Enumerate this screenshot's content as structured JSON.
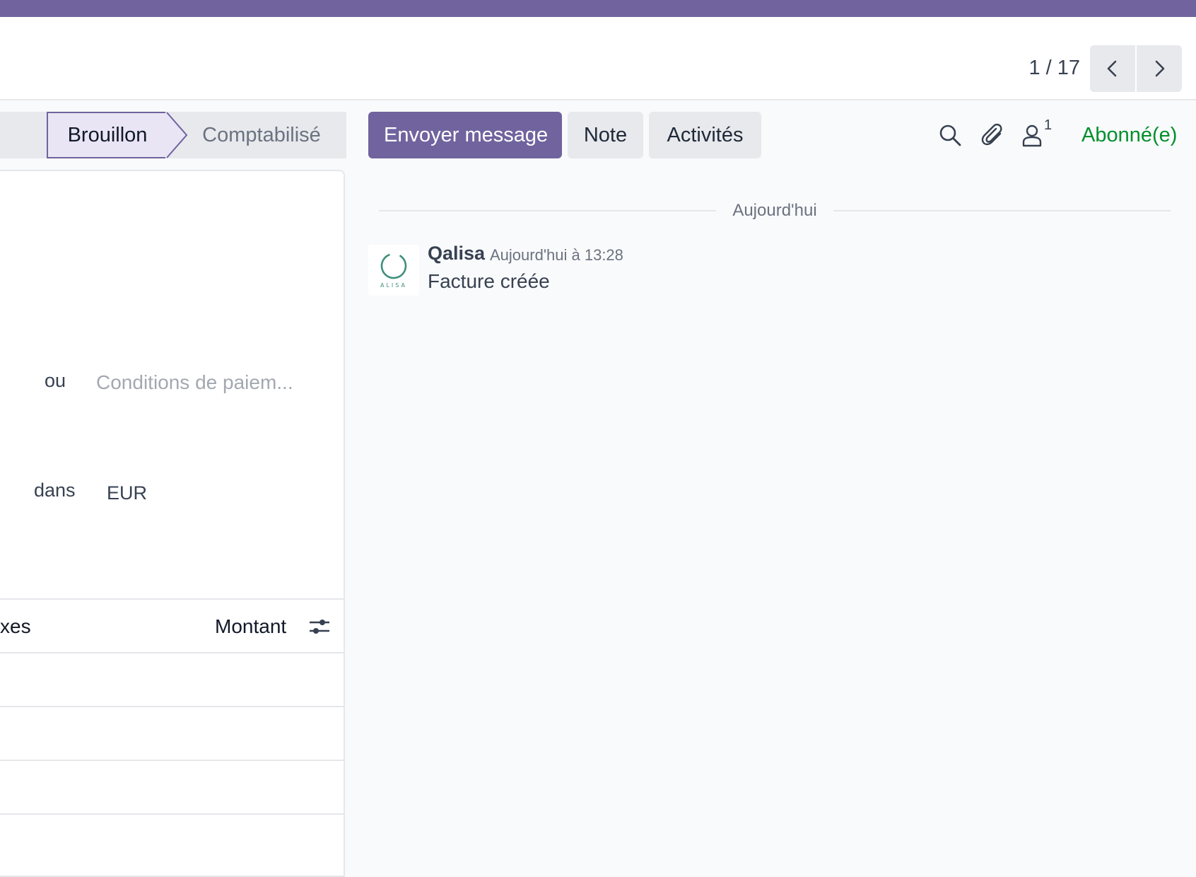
{
  "header": {
    "pager_value": "1 / 17",
    "prev_icon": "chevron-left-icon",
    "next_icon": "chevron-right-icon"
  },
  "statusbar": {
    "stages": [
      {
        "label": "Brouillon",
        "active": true
      },
      {
        "label": "Comptabilisé",
        "active": false
      }
    ]
  },
  "form": {
    "payment_or_label": "ou",
    "payment_terms_placeholder": "Conditions de paiem...",
    "currency_label": "dans",
    "currency_value": "EUR",
    "lines_table": {
      "columns": [
        "xes",
        "Montant"
      ],
      "settings_icon": "sliders-icon"
    }
  },
  "chatter": {
    "send_message_label": "Envoyer message",
    "note_label": "Note",
    "activities_label": "Activités",
    "search_icon": "search-icon",
    "attachment_icon": "paperclip-icon",
    "followers_icon": "user-icon",
    "followers_count": "1",
    "follow_status": "Abonné(e)",
    "date_separator": "Aujourd'hui",
    "messages": [
      {
        "author": "Qalisa",
        "date": "Aujourd'hui à 13:28",
        "body": "Facture créée",
        "avatar_text": "ALISA"
      }
    ]
  },
  "colors": {
    "brand": "#71639e",
    "follow_green": "#018f2c",
    "button_grey": "#e7e9ed"
  }
}
